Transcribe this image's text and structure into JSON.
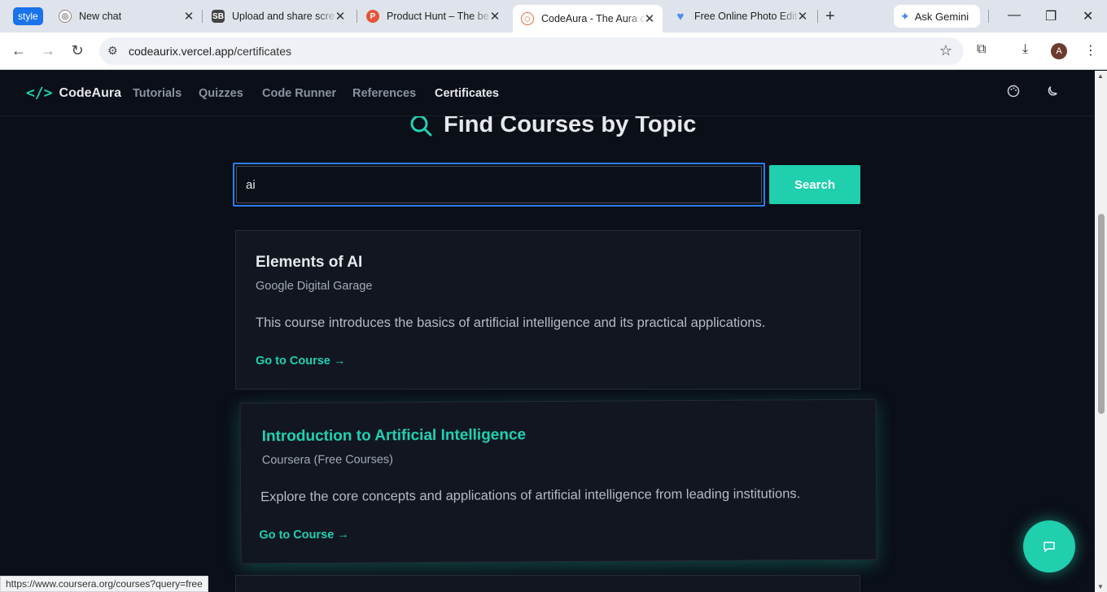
{
  "browser": {
    "style_chip": "style",
    "tabs": [
      {
        "title": "New chat"
      },
      {
        "title": "Upload and share scre"
      },
      {
        "title": "Product Hunt – The be"
      },
      {
        "title": "CodeAura - The Aura c"
      },
      {
        "title": "Free Online Photo Edit"
      }
    ],
    "gemini_label": "Ask Gemini",
    "url_host": "codeaurix.vercel.app",
    "url_path": "/certificates",
    "avatar_letter": "A",
    "status_url": "https://www.coursera.org/courses?query=free"
  },
  "site": {
    "brand": "CodeAura",
    "nav": [
      {
        "label": "Tutorials"
      },
      {
        "label": "Quizzes"
      },
      {
        "label": "Code Runner"
      },
      {
        "label": "References"
      },
      {
        "label": "Certificates"
      }
    ]
  },
  "main": {
    "heading": "Find Courses by Topic",
    "search_value": "ai",
    "search_button": "Search",
    "courses": [
      {
        "title": "Elements of AI",
        "provider": "Google Digital Garage",
        "description": "This course introduces the basics of artificial intelligence and its practical applications.",
        "link": "Go to Course →"
      },
      {
        "title": "Introduction to Artificial Intelligence",
        "provider": "Coursera (Free Courses)",
        "description": "Explore the core concepts and applications of artificial intelligence from leading institutions.",
        "link": "Go to Course →"
      }
    ]
  },
  "colors": {
    "accent": "#1fd1b2",
    "background": "#0b0f17",
    "card": "#111620",
    "focus_ring": "#2e7cf6"
  }
}
